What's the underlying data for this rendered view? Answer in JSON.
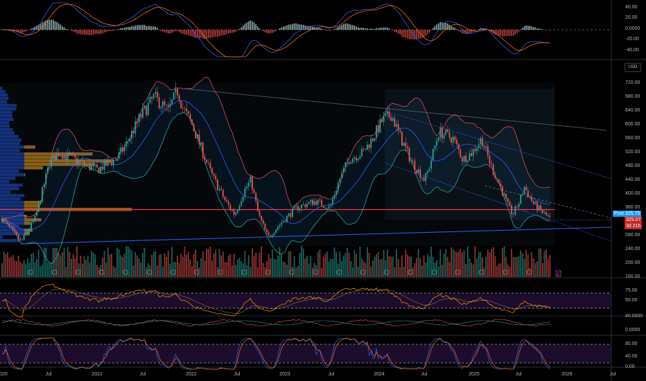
{
  "currency": "USD",
  "price_axis": [
    "720.00",
    "680.00",
    "640.00",
    "600.00",
    "560.00",
    "520.00",
    "480.00",
    "440.00",
    "400.00",
    "360.00",
    "280.00",
    "240.00",
    "200.00",
    "160.00"
  ],
  "macd_axis": [
    "40.00",
    "20.00",
    "0.0000",
    "-20.00",
    "-40.00"
  ],
  "rsi_axis": [
    "75.00",
    "50.00"
  ],
  "osc_axis": [
    "40.0000",
    "0.0000"
  ],
  "stoch_axis": [
    "80.00",
    "40.00",
    "0.00"
  ],
  "time_axis": [
    "2020",
    "Jul",
    "2021",
    "Jul",
    "2022",
    "Jul",
    "2023",
    "Jul",
    "2024",
    "Jul",
    "2025",
    "Jul",
    "2026",
    "Jul"
  ],
  "post_label": "Post",
  "post_price": "325.75",
  "last_price": "325.07",
  "countdown": "3d 21h",
  "earnings_marker": "E",
  "colors": {
    "up": "#26a69a",
    "down": "#ef5350",
    "support": "#f23645",
    "trend": "#2962ff",
    "post": "#2196f3"
  },
  "chart_data": {
    "type": "candlestick",
    "interval": "weekly",
    "ylim": [
      140,
      740
    ],
    "xlim": [
      2020.0,
      2026.6
    ],
    "price_path": [
      [
        2020.0,
        330
      ],
      [
        2020.2,
        262
      ],
      [
        2020.35,
        330
      ],
      [
        2020.5,
        490
      ],
      [
        2020.6,
        520
      ],
      [
        2020.9,
        480
      ],
      [
        2021.0,
        470
      ],
      [
        2021.2,
        500
      ],
      [
        2021.3,
        540
      ],
      [
        2021.45,
        620
      ],
      [
        2021.6,
        680
      ],
      [
        2021.75,
        640
      ],
      [
        2021.85,
        700
      ],
      [
        2021.9,
        650
      ],
      [
        2022.0,
        600
      ],
      [
        2022.2,
        460
      ],
      [
        2022.35,
        380
      ],
      [
        2022.45,
        340
      ],
      [
        2022.55,
        410
      ],
      [
        2022.62,
        440
      ],
      [
        2022.7,
        340
      ],
      [
        2022.8,
        275
      ],
      [
        2022.95,
        320
      ],
      [
        2023.1,
        360
      ],
      [
        2023.3,
        380
      ],
      [
        2023.45,
        360
      ],
      [
        2023.55,
        440
      ],
      [
        2023.65,
        500
      ],
      [
        2023.8,
        520
      ],
      [
        2023.9,
        560
      ],
      [
        2024.0,
        610
      ],
      [
        2024.1,
        630
      ],
      [
        2024.2,
        560
      ],
      [
        2024.3,
        500
      ],
      [
        2024.45,
        440
      ],
      [
        2024.5,
        480
      ],
      [
        2024.6,
        580
      ],
      [
        2024.75,
        560
      ],
      [
        2024.85,
        500
      ],
      [
        2024.95,
        520
      ],
      [
        2025.05,
        560
      ],
      [
        2025.15,
        480
      ],
      [
        2025.25,
        420
      ],
      [
        2025.32,
        370
      ],
      [
        2025.38,
        340
      ],
      [
        2025.45,
        380
      ],
      [
        2025.5,
        420
      ],
      [
        2025.6,
        370
      ],
      [
        2025.7,
        345
      ],
      [
        2025.78,
        325
      ]
    ],
    "support_level": 355,
    "indicators": [
      "MACD",
      "Bollinger Bands",
      "Volume",
      "Volume Profile",
      "RSI",
      "Oscillator",
      "Stochastic RSI"
    ]
  }
}
